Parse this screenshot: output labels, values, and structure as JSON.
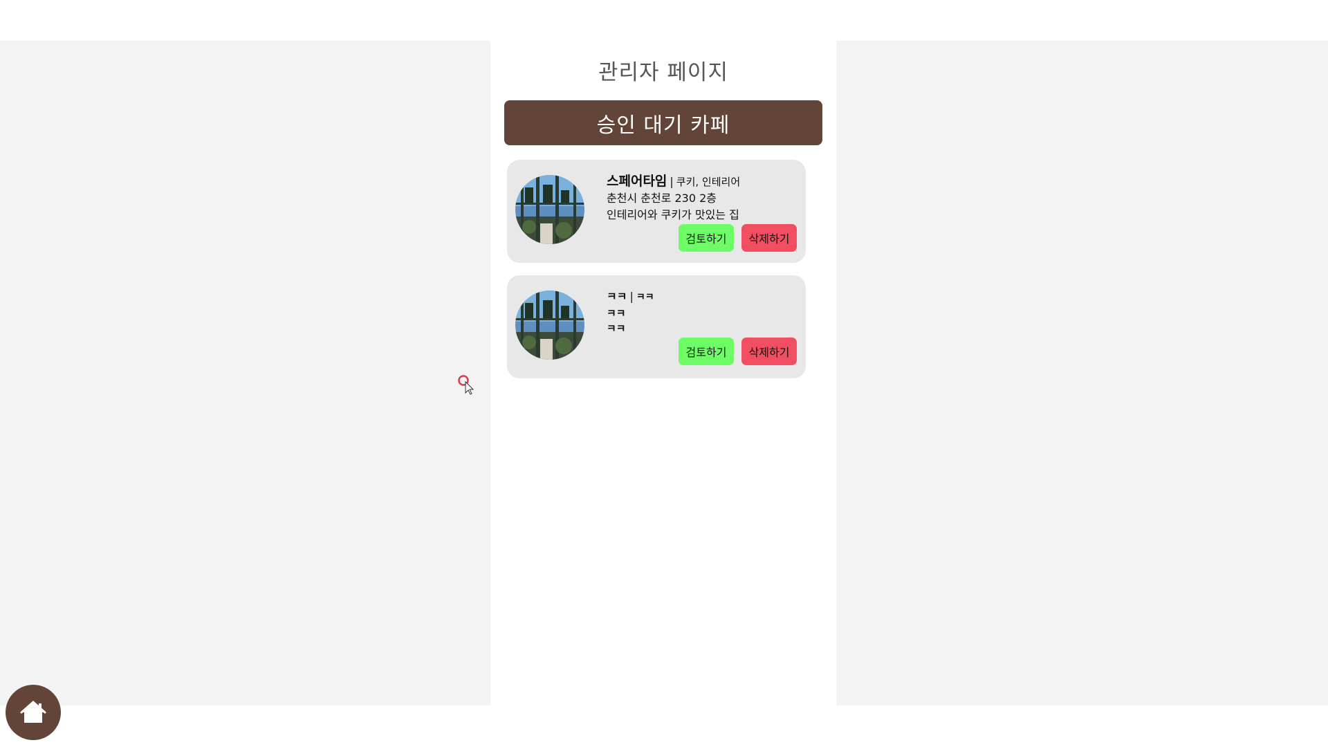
{
  "page": {
    "title": "관리자 페이지",
    "section_title": "승인 대기 카페"
  },
  "cafes": [
    {
      "name": "스페어타임",
      "separator": "|",
      "tags": "쿠키, 인테리어",
      "address": "춘천시 춘천로 230 2층",
      "description": "인테리어와 쿠키가 맛있는 집",
      "review_label": "검토하기",
      "delete_label": "삭제하기"
    },
    {
      "name": "ㅋㅋ",
      "separator": "|",
      "tags": "ㅋㅋ",
      "address": "ㅋㅋ",
      "description": "ㅋㅋ",
      "review_label": "검토하기",
      "delete_label": "삭제하기"
    }
  ],
  "colors": {
    "brand_brown": "#624438",
    "review_green": "#6dfb66",
    "delete_red": "#f24e61",
    "card_bg": "#e8e8e8",
    "page_bg": "#f3f3f3"
  },
  "icons": {
    "home_button": "home-icon",
    "cursor": "mouse-pointer-icon"
  }
}
